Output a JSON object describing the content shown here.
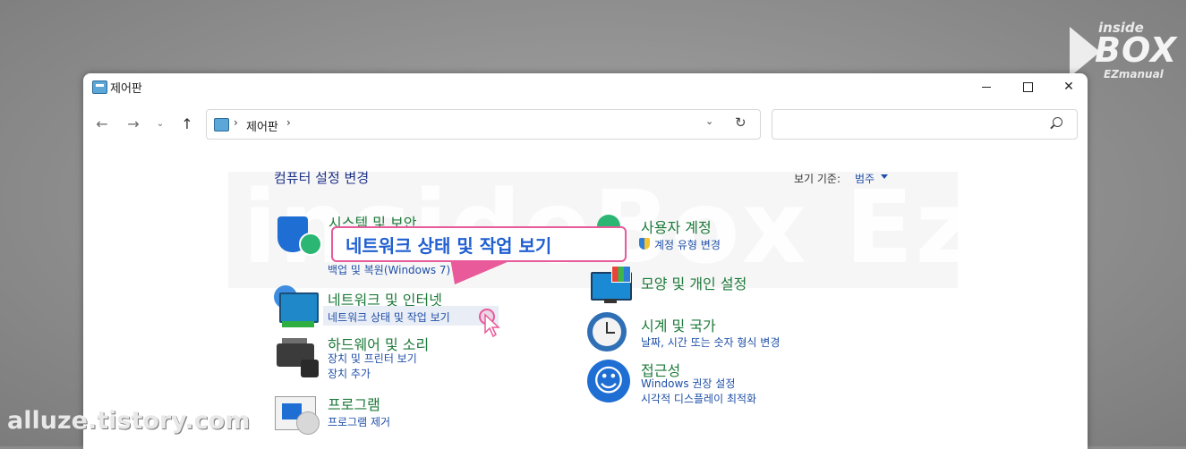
{
  "window": {
    "title": "제어판",
    "address_path": "제어판",
    "address_sep": "›",
    "search_placeholder": ""
  },
  "nav": {
    "back": "←",
    "forward": "→",
    "recent": "⌄",
    "up": "↑",
    "dropdown": "⌄",
    "refresh": "↻"
  },
  "header": {
    "title": "컴퓨터 설정 변경",
    "view_by_label": "보기 기준:",
    "view_by_value": "범주"
  },
  "categories_left": [
    {
      "title": "시스템 및 보안",
      "links": [
        "백업 및 복원(Windows 7)"
      ]
    },
    {
      "title": "네트워크 및 인터넷",
      "links": [
        "네트워크 상태 및 작업 보기"
      ]
    },
    {
      "title": "하드웨어 및 소리",
      "links": [
        "장치 및 프린터 보기",
        "장치 추가"
      ]
    },
    {
      "title": "프로그램",
      "links": [
        "프로그램 제거"
      ]
    }
  ],
  "categories_right": [
    {
      "title": "사용자 계정",
      "links": [
        "계정 유형 변경"
      ]
    },
    {
      "title": "모양 및 개인 설정",
      "links": []
    },
    {
      "title": "시계 및 국가",
      "links": [
        "날짜, 시간 또는 숫자 형식 변경"
      ]
    },
    {
      "title": "접근성",
      "links": [
        "Windows 권장 설정",
        "시각적 디스플레이 최적화"
      ]
    }
  ],
  "callout": {
    "text": "네트워크 상태 및 작업 보기",
    "color": "#e85a9a"
  },
  "watermarks": {
    "band": "insideBox Ezmanual",
    "logo_top": "inside",
    "logo_main": "BOX",
    "logo_sub": "EZmanual",
    "bottom": "alluze.tistory.com"
  },
  "colors": {
    "category_title": "#1d7a3a",
    "link": "#1f4fa8",
    "heading": "#1e3287"
  }
}
